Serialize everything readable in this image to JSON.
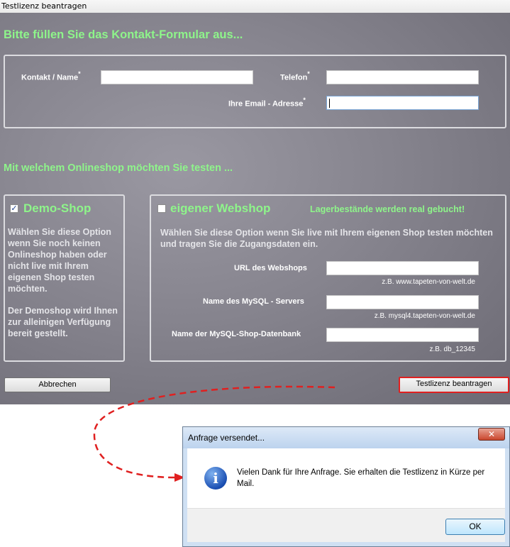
{
  "window": {
    "title": "Testlizenz beantragen"
  },
  "contact": {
    "heading": "Bitte füllen Sie das Kontakt-Formular aus...",
    "name_label": "Kontakt / Name",
    "phone_label": "Telefon",
    "email_label": "Ihre Email - Adresse",
    "required_mark": "*",
    "name_value": "",
    "phone_value": "",
    "email_value": ""
  },
  "shop": {
    "heading": "Mit welchem Onlineshop möchten Sie testen ...",
    "demo": {
      "checked": true,
      "check_glyph": "✓",
      "label": "Demo-Shop",
      "description1": "Wählen Sie diese Option wenn Sie noch keinen Onlineshop haben oder nicht live mit Ihrem eigenen Shop testen möchten.",
      "description2": "Der Demoshop wird Ihnen zur alleinigen Verfügung bereit gestellt."
    },
    "own": {
      "checked": false,
      "label": "eigener Webshop",
      "warning": "Lagerbestände werden real gebucht!",
      "description": "Wählen Sie diese Option wenn Sie live mit Ihrem eigenen Shop testen möchten und tragen Sie die Zugangsdaten ein.",
      "url_label": "URL des Webshops",
      "url_hint": "z.B. www.tapeten-von-welt.de",
      "mysql_label": "Name des MySQL - Servers",
      "mysql_hint": "z.B. mysql4.tapeten-von-welt.de",
      "db_label": "Name der MySQL-Shop-Datenbank",
      "db_hint": "z.B. db_12345"
    }
  },
  "buttons": {
    "cancel": "Abbrechen",
    "submit": "Testlizenz beantragen"
  },
  "dialog": {
    "title": "Anfrage versendet...",
    "close": "✕",
    "icon": "info-icon",
    "icon_glyph": "i",
    "message": "Vielen Dank für Ihre Anfrage. Sie erhalten die Testlizenz in Kürze per Mail.",
    "ok": "OK"
  },
  "colors": {
    "accent_green": "#8ef58a",
    "arrow_red": "#e02020",
    "background": "#86848e"
  }
}
